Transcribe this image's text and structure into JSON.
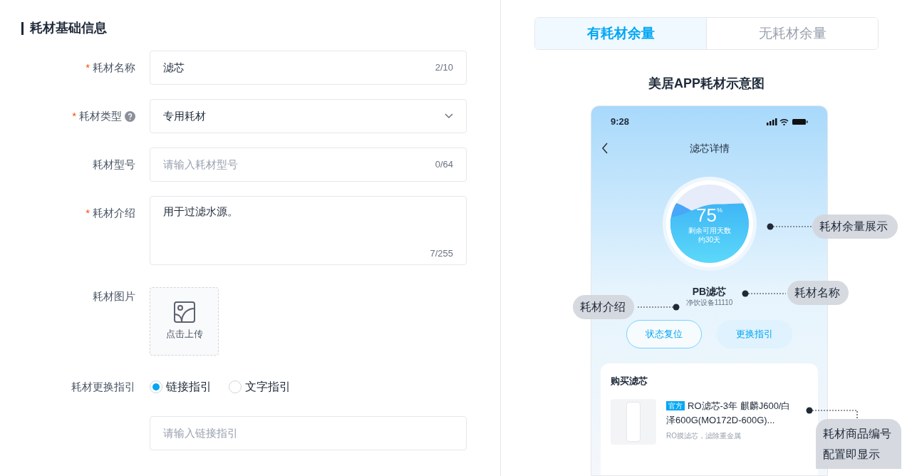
{
  "section_title": "耗材基础信息",
  "fields": [
    {
      "kind": "text",
      "label": "耗材名称",
      "required_mark": "*",
      "value": "滤芯",
      "counter": "2/10"
    },
    {
      "kind": "select",
      "label": "耗材类型",
      "required_mark": "*",
      "help_icon": true,
      "value": "专用耗材"
    },
    {
      "kind": "text",
      "label": "耗材型号",
      "placeholder": "请输入耗材型号",
      "counter": "0/64"
    },
    {
      "kind": "textarea",
      "label": "耗材介绍",
      "required_mark": "*",
      "value": "用于过滤水源。",
      "counter": "7/255"
    },
    {
      "kind": "upload",
      "label": "耗材图片",
      "upload_text": "点击上传"
    },
    {
      "kind": "radio",
      "label": "耗材更换指引",
      "options": [
        {
          "label": "链接指引",
          "selected": true
        },
        {
          "label": "文字指引",
          "selected": false
        }
      ]
    },
    {
      "kind": "text",
      "placeholder": "请输入链接指引"
    }
  ],
  "tabs": [
    {
      "label": "有耗材余量",
      "selected": true
    },
    {
      "label": "无耗材余量",
      "selected": false
    }
  ],
  "preview_title": "美居APP耗材示意图",
  "phone": {
    "time": "9:28",
    "title": "滤芯详情",
    "gauge": {
      "percent": "75",
      "unit": "%",
      "line1": "剩余可用天数",
      "line2": "约30天",
      "level": 0.75
    },
    "product_name": "PB滤芯",
    "device": "净饮设备11110",
    "buttons": [
      "状态复位",
      "更换指引"
    ],
    "buy": {
      "title": "购买滤芯",
      "tag": "官方",
      "name": "RO滤芯-3年 麒麟J600/白泽600G(MO172D-600G)...",
      "description": "RO膜滤芯，滤除重金属"
    }
  },
  "callouts": [
    "耗材余量展示",
    "耗材名称",
    "耗材介绍",
    "耗材商品编号配置即显示"
  ]
}
